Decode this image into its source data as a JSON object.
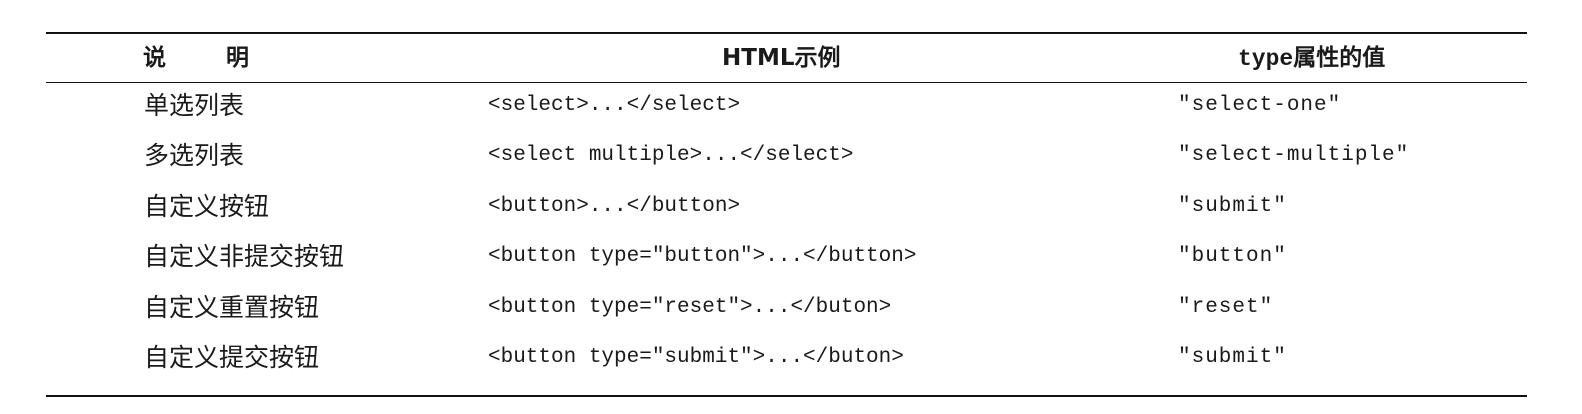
{
  "table": {
    "headers": {
      "description": "说明",
      "example": "HTML示例",
      "type_code": "type",
      "type_suffix": "属性的值"
    },
    "rows": [
      {
        "description": "单选列表",
        "example": "<select>...</select>",
        "type_value": "\"select-one\""
      },
      {
        "description": "多选列表",
        "example": "<select multiple>...</select>",
        "type_value": "\"select-multiple\""
      },
      {
        "description": "自定义按钮",
        "example": "<button>...</button>",
        "type_value": "\"submit\""
      },
      {
        "description": "自定义非提交按钮",
        "example": "<button type=\"button\">...</button>",
        "type_value": "\"button\""
      },
      {
        "description": "自定义重置按钮",
        "example": "<button type=\"reset\">...</buton>",
        "type_value": "\"reset\""
      },
      {
        "description": "自定义提交按钮",
        "example": "<button type=\"submit\">...</buton>",
        "type_value": "\"submit\""
      }
    ]
  }
}
